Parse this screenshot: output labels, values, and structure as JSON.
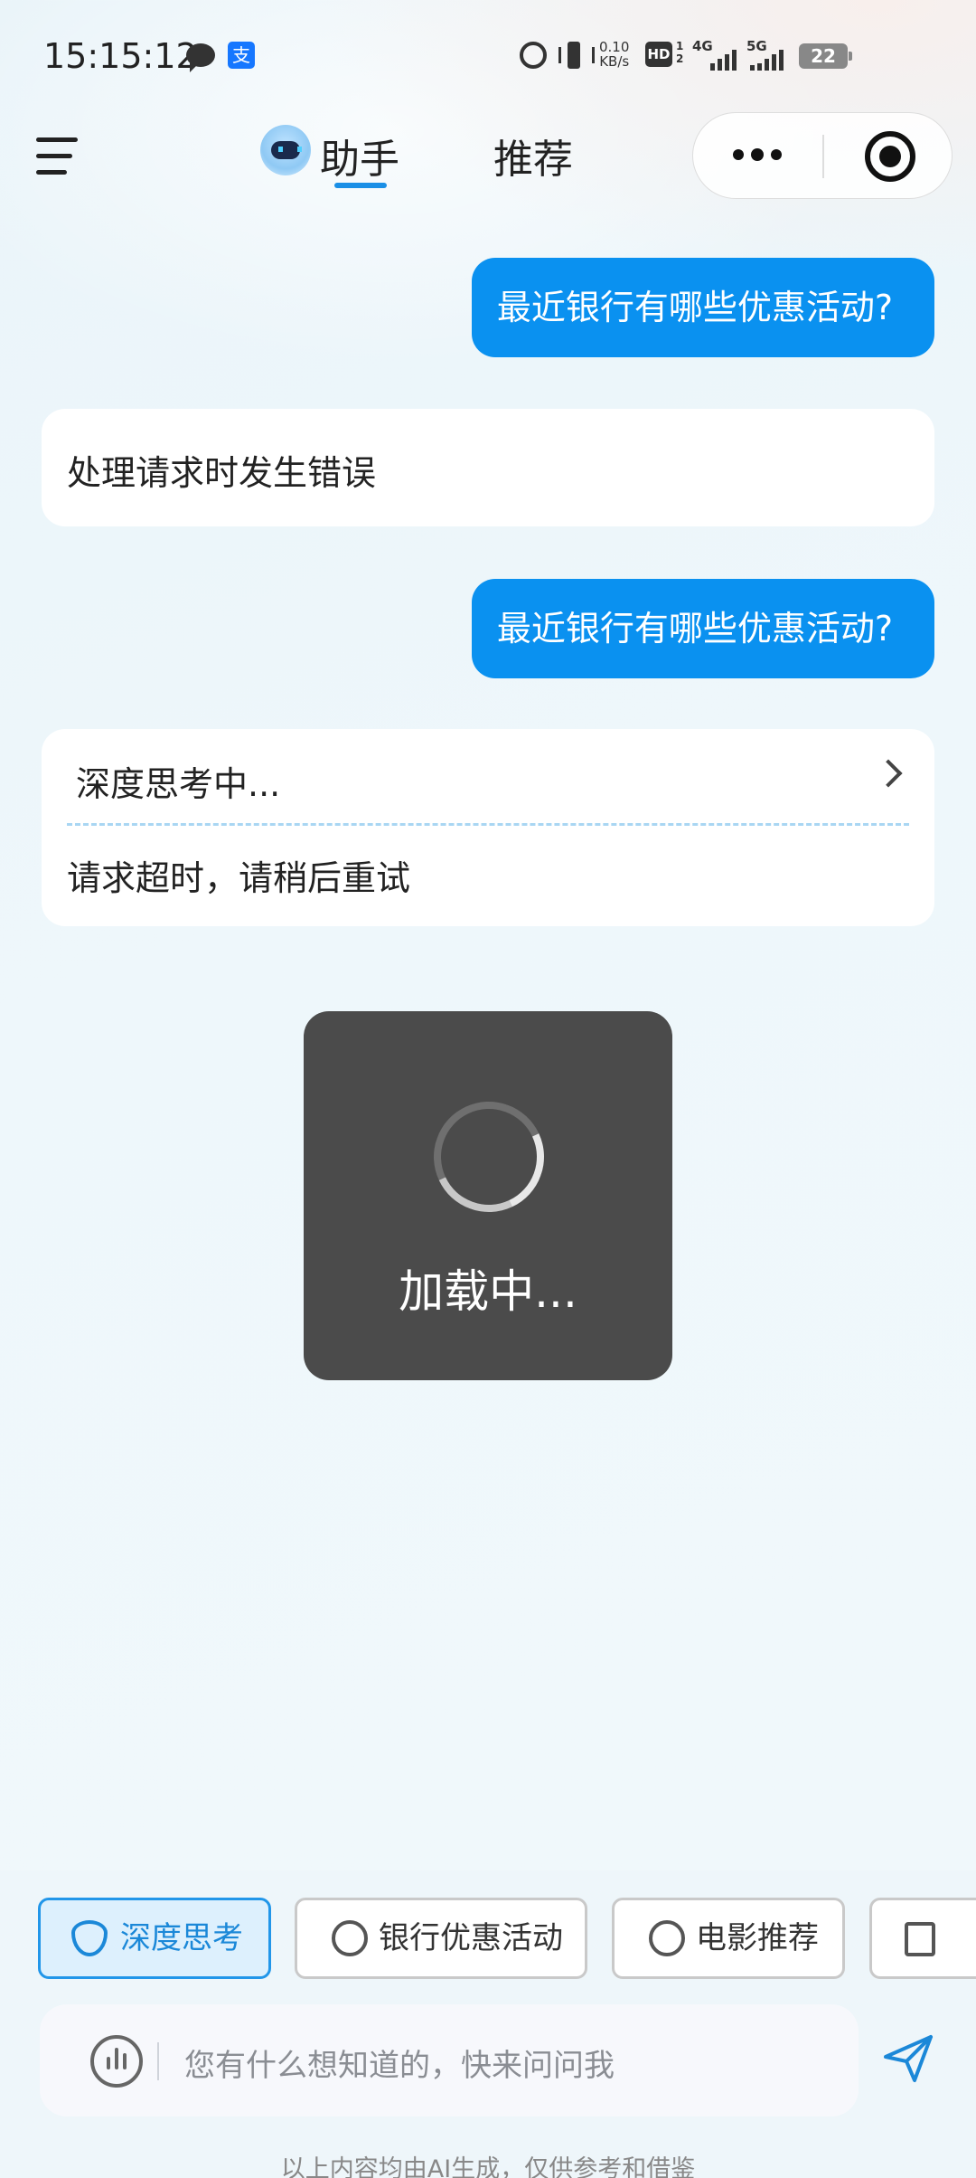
{
  "status_bar": {
    "time": "15:15:12",
    "net_speed_value": "0.10",
    "net_speed_unit": "KB/s",
    "hd_label": "HD",
    "hd_sub": "1 2",
    "signal_1": "4G",
    "signal_2": "5G",
    "battery": "22",
    "icons": [
      "chat-bubble-icon",
      "alipay-icon",
      "alarm-icon",
      "vibrate-icon",
      "hd-icon",
      "signal-icon",
      "battery-icon"
    ]
  },
  "header": {
    "tabs": [
      {
        "label": "助手",
        "active": true
      },
      {
        "label": "推荐",
        "active": false
      }
    ],
    "accent_color": "#1a8fe6"
  },
  "chat": {
    "messages": [
      {
        "role": "user",
        "text": "最近银行有哪些优惠活动?"
      },
      {
        "role": "assistant",
        "text": "处理请求时发生错误"
      },
      {
        "role": "user",
        "text": "最近银行有哪些优惠活动?"
      },
      {
        "role": "assistant",
        "thinking_label": "深度思考中...",
        "text": "请求超时，请稍后重试"
      }
    ],
    "user_bubble_color": "#0a91f0"
  },
  "loading": {
    "text": "加载中..."
  },
  "chips": [
    {
      "label": "深度思考",
      "active": true
    },
    {
      "label": "银行优惠活动",
      "active": false
    },
    {
      "label": "电影推荐",
      "active": false
    }
  ],
  "input": {
    "placeholder": "您有什么想知道的，快来问问我"
  },
  "footer": {
    "disclaimer": "以上内容均由AI生成，仅供参考和借鉴"
  }
}
